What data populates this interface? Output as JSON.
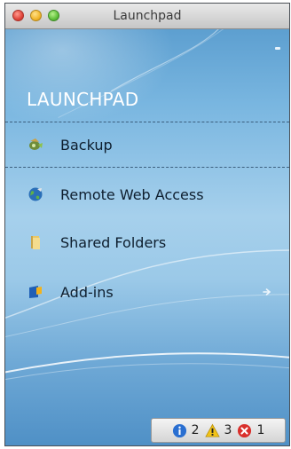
{
  "window": {
    "title": "Launchpad"
  },
  "heading": "LAUNCHPAD",
  "items": [
    {
      "label": "Backup",
      "icon": "backup-icon",
      "selected": true
    },
    {
      "label": "Remote Web Access",
      "icon": "globe-icon",
      "selected": false
    },
    {
      "label": "Shared Folders",
      "icon": "folder-icon",
      "selected": false
    },
    {
      "label": "Add-ins",
      "icon": "add-ins-icon",
      "selected": false,
      "has_arrow": true
    }
  ],
  "status": {
    "info_count": "2",
    "warning_count": "3",
    "error_count": "1"
  },
  "colors": {
    "info": "#2a6fd1",
    "warning": "#f2c316",
    "error": "#d9302c"
  }
}
